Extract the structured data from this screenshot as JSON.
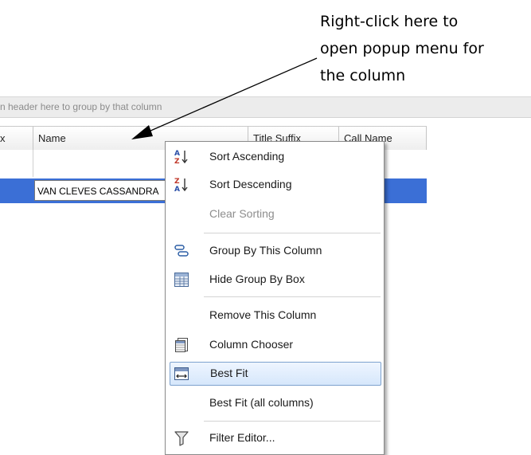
{
  "annotation": {
    "lines": [
      "Right-click here to",
      "open popup menu for",
      "the column"
    ]
  },
  "grid": {
    "group_box_text": "n header here to group by that column",
    "columns": [
      {
        "label": "x"
      },
      {
        "label": "Name"
      },
      {
        "label": "Title Suffix"
      },
      {
        "label": "Call Name"
      }
    ],
    "selected_row": {
      "name": "VAN CLEVES CASSANDRA"
    }
  },
  "context_menu": {
    "items": [
      {
        "label": "Sort Ascending",
        "icon": "sort-ascending-icon",
        "enabled": true
      },
      {
        "label": "Sort Descending",
        "icon": "sort-descending-icon",
        "enabled": true
      },
      {
        "label": "Clear Sorting",
        "icon": "",
        "enabled": false
      },
      {
        "label": "Group By This Column",
        "icon": "group-by-icon",
        "enabled": true
      },
      {
        "label": "Hide Group By Box",
        "icon": "group-box-icon",
        "enabled": true
      },
      {
        "label": "Remove This Column",
        "icon": "",
        "enabled": true
      },
      {
        "label": "Column Chooser",
        "icon": "column-chooser-icon",
        "enabled": true
      },
      {
        "label": "Best Fit",
        "icon": "best-fit-icon",
        "enabled": true,
        "highlighted": true
      },
      {
        "label": "Best Fit (all columns)",
        "icon": "",
        "enabled": true
      },
      {
        "label": "Filter Editor...",
        "icon": "filter-icon",
        "enabled": true
      }
    ]
  },
  "colors": {
    "selection": "#3b6fd6",
    "menu_highlight_border": "#7da2ce",
    "arrow": "#000000"
  }
}
